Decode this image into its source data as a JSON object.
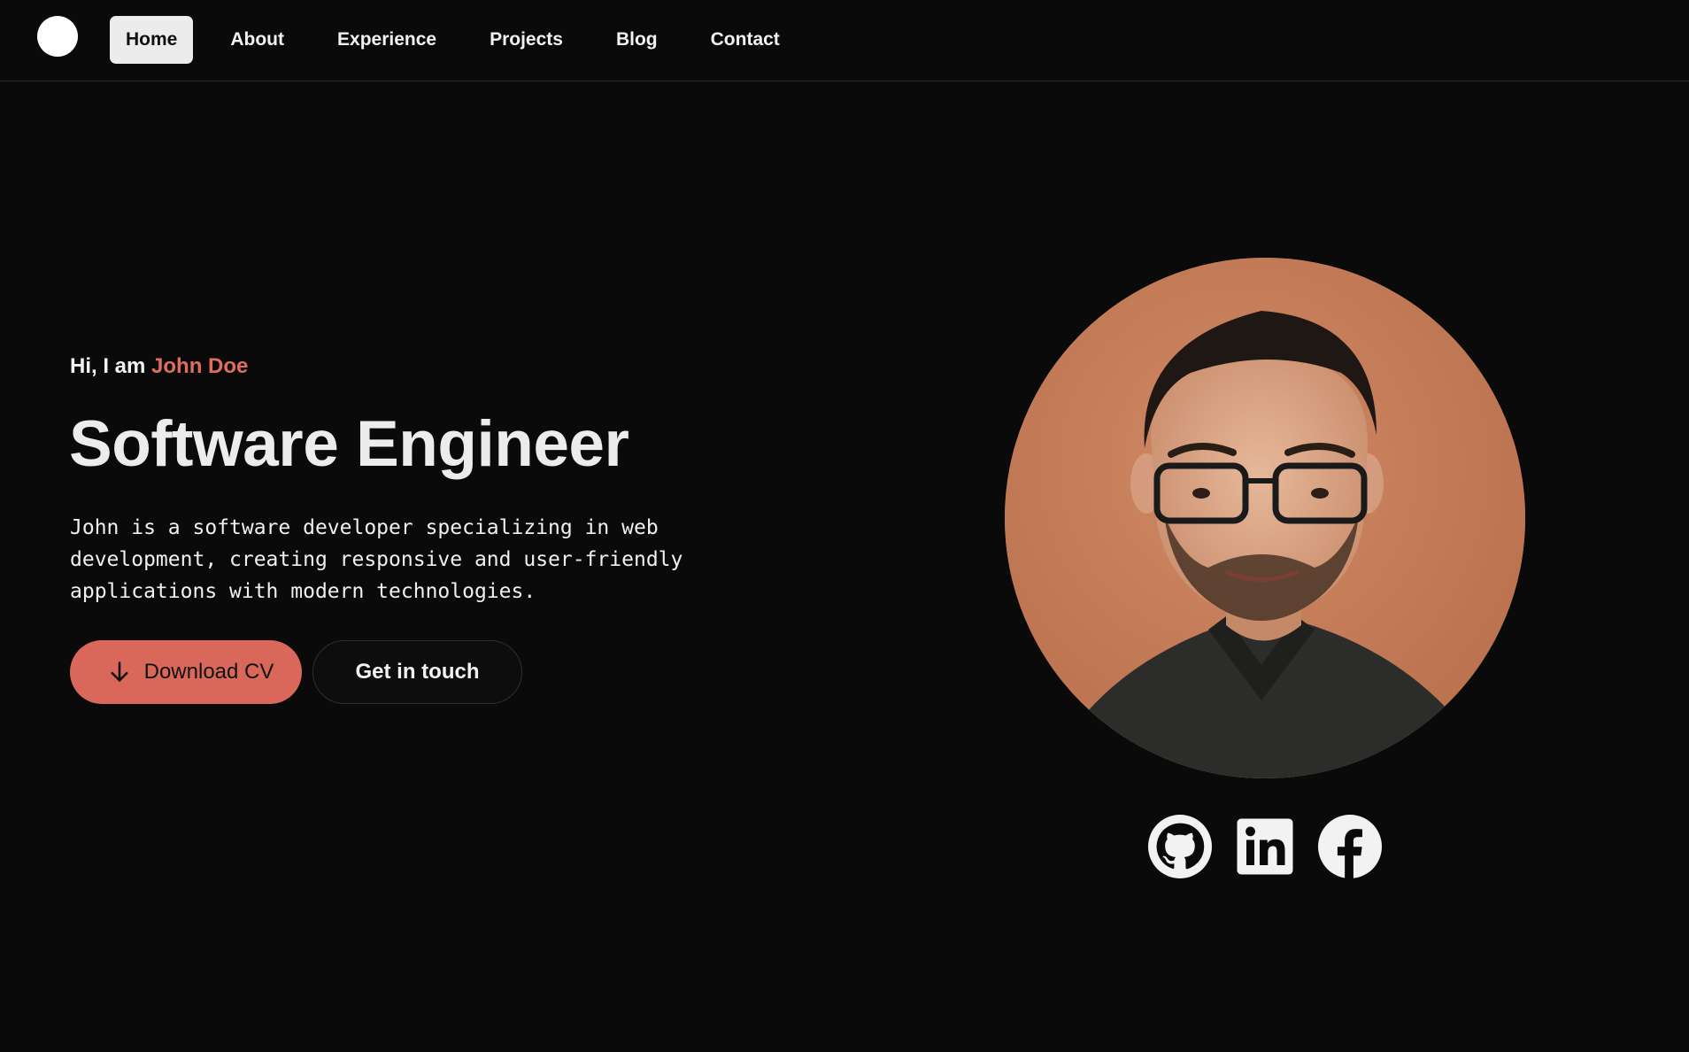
{
  "nav": {
    "items": [
      {
        "label": "Home",
        "active": true
      },
      {
        "label": "About",
        "active": false
      },
      {
        "label": "Experience",
        "active": false
      },
      {
        "label": "Projects",
        "active": false
      },
      {
        "label": "Blog",
        "active": false
      },
      {
        "label": "Contact",
        "active": false
      }
    ]
  },
  "hero": {
    "greeting_prefix": "Hi, I am ",
    "name": "John Doe",
    "title": "Software Engineer",
    "description": "John is a software developer specializing in web development, creating responsive and user-friendly applications with modern technologies.",
    "primary_button": {
      "label": "Download CV",
      "icon": "arrow-down-icon"
    },
    "secondary_button": {
      "label": "Get in touch"
    }
  },
  "socials": [
    {
      "name": "github",
      "icon": "github-icon"
    },
    {
      "name": "linkedin",
      "icon": "linkedin-icon"
    },
    {
      "name": "facebook",
      "icon": "facebook-icon"
    }
  ],
  "colors": {
    "background": "#0a0a0a",
    "accent": "#e06e5c",
    "button_primary": "#d9685a",
    "portrait_bg": "#c87c5a",
    "text": "#f2f2f2"
  }
}
